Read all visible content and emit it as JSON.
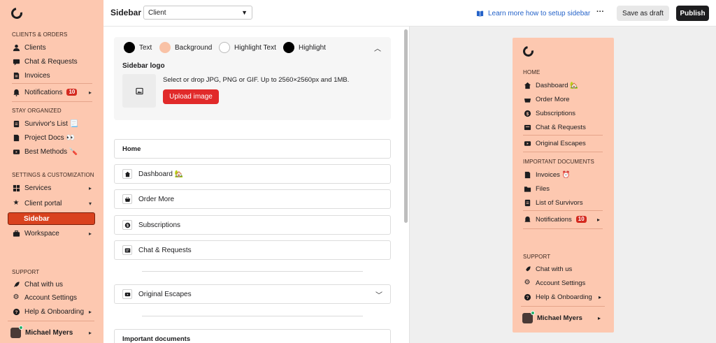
{
  "left_sidebar": {
    "sections": {
      "clients_orders": "CLIENTS & ORDERS",
      "stay_organized": "STAY ORGANIZED",
      "settings": "SETTINGS & CUSTOMIZATION",
      "support": "SUPPORT"
    },
    "items": {
      "clients": "Clients",
      "chat": "Chat & Requests",
      "invoices": "Invoices",
      "notifications": "Notifications",
      "notifications_badge": "10",
      "survivors_list": "Survivor's List 📃",
      "project_docs": "Project Docs 👀",
      "best_methods": "Best Methods 🪛",
      "services": "Services",
      "client_portal": "Client portal",
      "sidebar": "Sidebar",
      "workspace": "Workspace",
      "chat_with_us": "Chat with us",
      "account_settings": "Account Settings",
      "help": "Help & Onboarding",
      "user": "Michael Myers"
    }
  },
  "topbar": {
    "title": "Sidebar",
    "select_value": "Client",
    "learn_more": "Learn more how to setup sidebar",
    "more": "···",
    "save_draft": "Save as draft",
    "publish": "Publish"
  },
  "editor": {
    "colors": {
      "text_label": "Text",
      "background_label": "Background",
      "highlight_text_label": "Highlight Text",
      "highlight_label": "Highlight",
      "text_color": "#000000",
      "background_color": "#f9c2a6",
      "highlight_text_color": "#ffffff",
      "highlight_color": "#000000"
    },
    "logo": {
      "title": "Sidebar logo",
      "hint": "Select or drop JPG, PNG or GIF. Up to 2560×2560px and 1MB.",
      "upload": "Upload image"
    },
    "items": {
      "home": "Home",
      "dashboard": "Dashboard 🏡",
      "order_more": "Order More",
      "subscriptions": "Subscriptions",
      "chat": "Chat & Requests",
      "original_escapes": "Original Escapes",
      "important_documents": "Important documents"
    }
  },
  "preview": {
    "sections": {
      "home": "HOME",
      "important": "IMPORTANT DOCUMENTS",
      "support": "SUPPORT"
    },
    "items": {
      "dashboard": "Dashboard 🏡",
      "order_more": "Order More",
      "subscriptions": "Subscriptions",
      "chat": "Chat & Requests",
      "original_escapes": "Original Escapes",
      "invoices": "Invoices ⏰",
      "files": "Files",
      "list_survivors": "List of Survivors",
      "notifications": "Notifications",
      "notifications_badge": "10",
      "chat_with_us": "Chat with us",
      "account_settings": "Account Settings",
      "help": "Help & Onboarding",
      "user": "Michael Myers"
    }
  },
  "icons": [
    "logo-icon",
    "user-icon",
    "chat-icon",
    "invoice-icon",
    "bell-icon",
    "list-icon",
    "doc-icon",
    "video-icon",
    "grid-icon",
    "star-icon",
    "briefcase-icon",
    "rocket-icon",
    "gear-icon",
    "help-icon",
    "home-icon",
    "basket-icon",
    "dollar-icon",
    "image-icon",
    "book-icon",
    "folder-icon",
    "chevron-right-icon",
    "chevron-down-icon",
    "chevron-up-icon"
  ]
}
